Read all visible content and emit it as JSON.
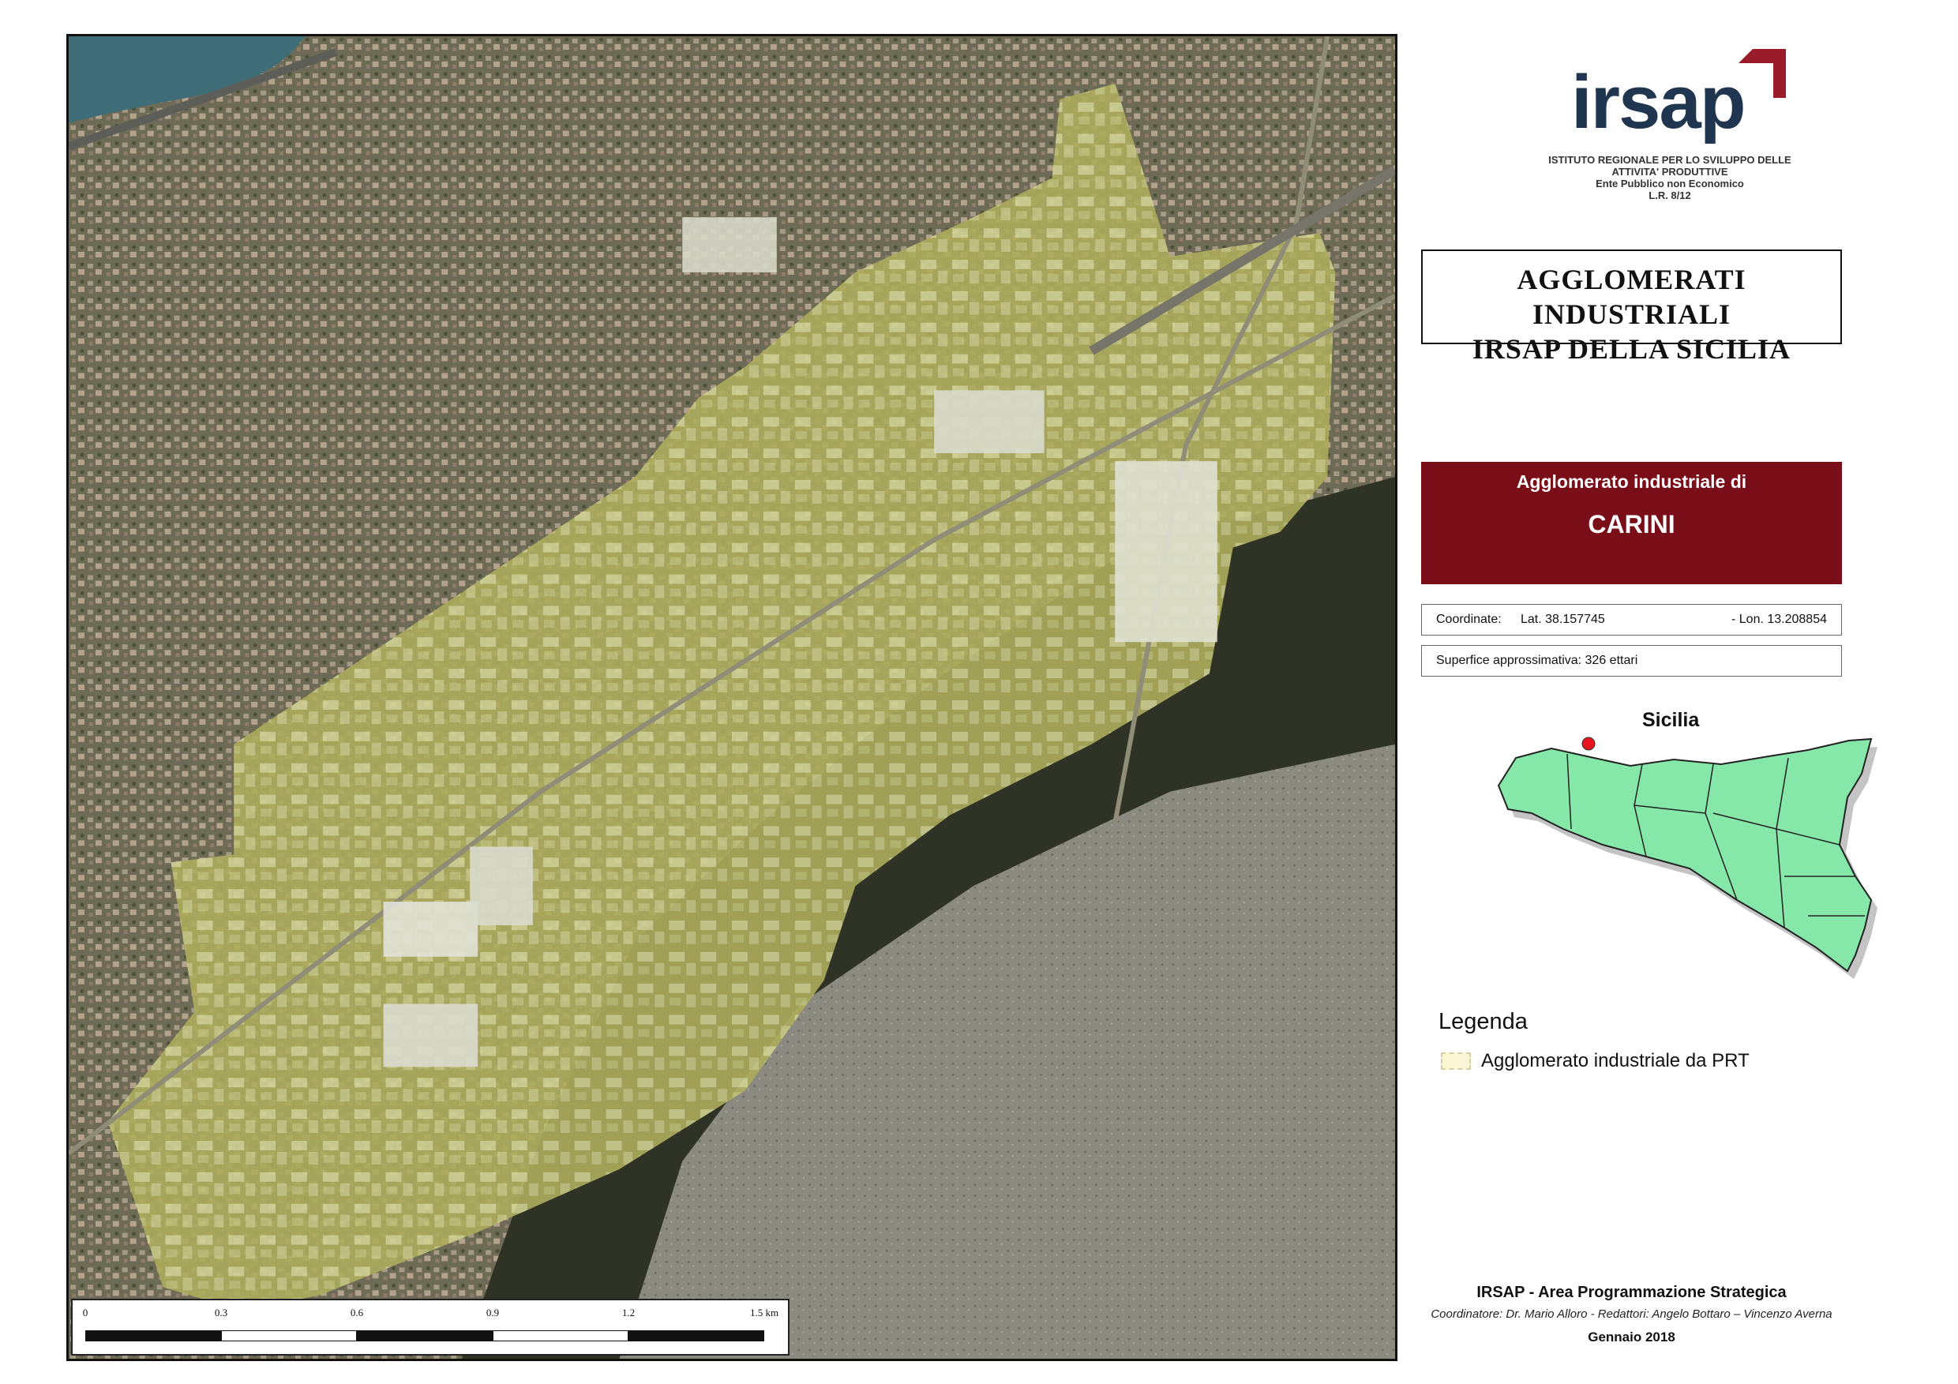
{
  "logo": {
    "brand": "irsap",
    "line1": "ISTITUTO REGIONALE PER LO SVILUPPO DELLE",
    "line2": "ATTIVITA' PRODUTTIVE",
    "line3": "Ente Pubblico non Economico",
    "line4": "L.R. 8/12"
  },
  "title": {
    "line1": "AGGLOMERATI INDUSTRIALI",
    "line2": "IRSAP DELLA SICILIA"
  },
  "site": {
    "subtitle": "Agglomerato industriale di",
    "name": "CARINI",
    "coord_label": "Coordinate:",
    "lat_text": "Lat. 38.157745",
    "lon_text": "- Lon. 13.208854",
    "area_text": "Superfice approssimativa:  326 ettari",
    "latitude": 38.157745,
    "longitude": 13.208854,
    "area_ha": 326
  },
  "inset": {
    "label": "Sicilia",
    "fill_color": "#86e8a8",
    "marker_color": "#e8141c"
  },
  "legend": {
    "title": "Legenda",
    "item": "Agglomerato industriale da PRT",
    "swatch_color": "#fbf7d6"
  },
  "scale": {
    "ticks": [
      "0",
      "0.3",
      "0.6",
      "0.9",
      "1.2",
      "1.5 km"
    ]
  },
  "footer": {
    "title": "IRSAP - Area Programmazione Strategica",
    "credits": "Coordinatore: Dr. Mario Alloro  -  Redattori: Angelo Bottaro – Vincenzo Averna",
    "date": "Gennaio 2018"
  },
  "colors": {
    "accent_red": "#7a0e18",
    "logo_blue": "#1f3550",
    "industrial_overlay": "#c8c85a"
  }
}
